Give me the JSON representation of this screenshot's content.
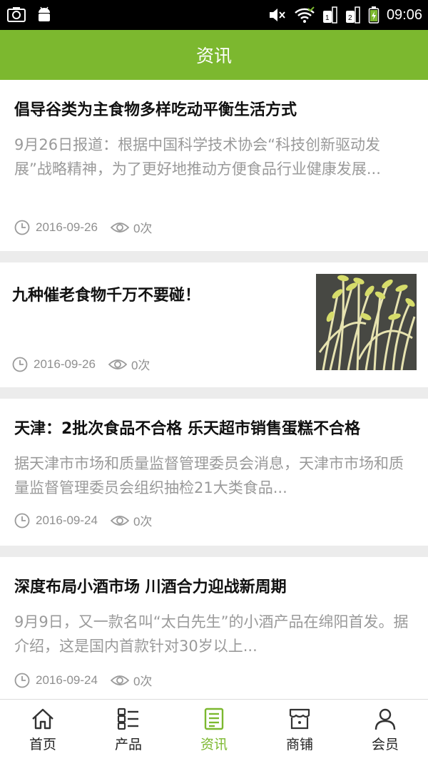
{
  "status_bar": {
    "time": "09:06",
    "icons": [
      "camera-icon",
      "android-icon",
      "mute-icon",
      "wifi-icon",
      "sim1-icon",
      "sim2-icon",
      "battery-charging-icon"
    ]
  },
  "header": {
    "title": "资讯"
  },
  "articles": [
    {
      "title": "倡导谷类为主食物多样吃动平衡生活方式",
      "summary": "9月26日报道：根据中国科学技术协会“科技创新驱动发展”战略精神，为了更好地推动方便食品行业健康发展...",
      "date": "2016-09-26",
      "views": "0次"
    },
    {
      "title": "九种催老食物千万不要碰！",
      "date": "2016-09-26",
      "views": "0次",
      "thumbnail": "bean-sprouts-image"
    },
    {
      "title": "天津：2批次食品不合格 乐天超市销售蛋糕不合格",
      "summary": " 据天津市市场和质量监督管理委员会消息，天津市市场和质量监督管理委员会组织抽检21大类食品...",
      "date": "2016-09-24",
      "views": "0次"
    },
    {
      "title": "深度布局小酒市场 川酒合力迎战新周期",
      "summary": " 9月9日，又一款名叫“太白先生”的小酒产品在绵阳首发。据介绍，这是国内首款针对30岁以上...",
      "date": "2016-09-24",
      "views": "0次"
    }
  ],
  "tabbar": {
    "items": [
      {
        "label": "首页",
        "icon": "home-icon"
      },
      {
        "label": "产品",
        "icon": "list-icon"
      },
      {
        "label": "资讯",
        "icon": "news-icon",
        "active": true
      },
      {
        "label": "商铺",
        "icon": "shop-icon"
      },
      {
        "label": "会员",
        "icon": "user-icon"
      }
    ]
  },
  "colors": {
    "accent": "#7cb82f",
    "status_bar": "#000000",
    "divider": "#ececec"
  }
}
